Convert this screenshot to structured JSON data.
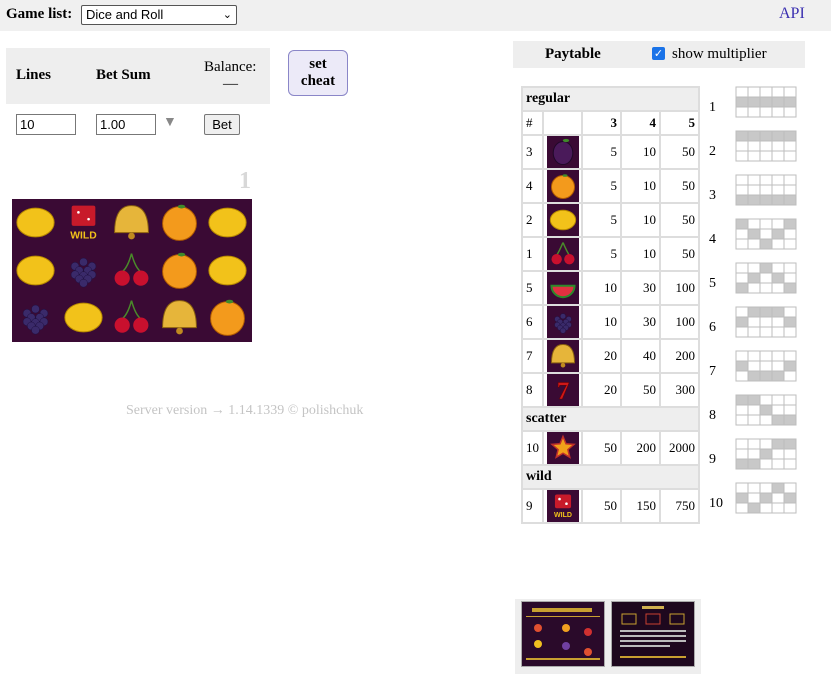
{
  "header": {
    "game_list_label": "Game list:",
    "selected_game": "Dice and Roll",
    "api_link": "API"
  },
  "controls": {
    "lines_label": "Lines",
    "bet_sum_label": "Bet Sum",
    "balance_label": "Balance:",
    "balance_value": "—",
    "cheat_line1": "set",
    "cheat_line2": "cheat",
    "lines_value": "10",
    "bet_value": "1.00",
    "bet_button": "Bet",
    "arrow": "▼"
  },
  "reels": {
    "number": "1",
    "grid": [
      [
        "lemon",
        "dice-wild",
        "bell",
        "orange",
        "lemon"
      ],
      [
        "lemon",
        "grapes",
        "cherry",
        "orange",
        "lemon"
      ],
      [
        "grapes",
        "lemon",
        "cherry",
        "bell",
        "orange"
      ]
    ]
  },
  "footer": {
    "text": "Server version → 1.14.1339   ©   polishchuk"
  },
  "paytable": {
    "title": "Paytable",
    "show_multiplier_label": "show multiplier",
    "show_multiplier_checked": true,
    "sections": [
      {
        "name": "regular",
        "header": [
          "#",
          "",
          "3",
          "4",
          "5"
        ],
        "rows": [
          {
            "id": "3",
            "icon": "plum",
            "v3": "5",
            "v4": "10",
            "v5": "50"
          },
          {
            "id": "4",
            "icon": "orange",
            "v3": "5",
            "v4": "10",
            "v5": "50"
          },
          {
            "id": "2",
            "icon": "lemon",
            "v3": "5",
            "v4": "10",
            "v5": "50"
          },
          {
            "id": "1",
            "icon": "cherry",
            "v3": "5",
            "v4": "10",
            "v5": "50"
          },
          {
            "id": "5",
            "icon": "watermelon",
            "v3": "10",
            "v4": "30",
            "v5": "100"
          },
          {
            "id": "6",
            "icon": "grapes",
            "v3": "10",
            "v4": "30",
            "v5": "100"
          },
          {
            "id": "7",
            "icon": "bell",
            "v3": "20",
            "v4": "40",
            "v5": "200"
          },
          {
            "id": "8",
            "icon": "seven",
            "v3": "20",
            "v4": "50",
            "v5": "300"
          }
        ]
      },
      {
        "name": "scatter",
        "rows": [
          {
            "id": "10",
            "icon": "star",
            "v3": "50",
            "v4": "200",
            "v5": "2000"
          }
        ]
      },
      {
        "name": "wild",
        "rows": [
          {
            "id": "9",
            "icon": "dice-wild",
            "v3": "50",
            "v4": "150",
            "v5": "750"
          }
        ]
      }
    ]
  },
  "paylines": [
    {
      "n": "1",
      "rows": [
        1,
        1,
        1,
        1,
        1
      ]
    },
    {
      "n": "2",
      "rows": [
        0,
        0,
        0,
        0,
        0
      ]
    },
    {
      "n": "3",
      "rows": [
        2,
        2,
        2,
        2,
        2
      ]
    },
    {
      "n": "4",
      "rows": [
        0,
        1,
        2,
        1,
        0
      ]
    },
    {
      "n": "5",
      "rows": [
        2,
        1,
        0,
        1,
        2
      ]
    },
    {
      "n": "6",
      "rows": [
        1,
        0,
        0,
        0,
        1
      ]
    },
    {
      "n": "7",
      "rows": [
        1,
        2,
        2,
        2,
        1
      ]
    },
    {
      "n": "8",
      "rows": [
        0,
        0,
        1,
        2,
        2
      ]
    },
    {
      "n": "9",
      "rows": [
        2,
        2,
        1,
        0,
        0
      ]
    },
    {
      "n": "10",
      "rows": [
        1,
        2,
        1,
        0,
        1
      ]
    }
  ],
  "colors": {
    "accent": "#1a73e8",
    "link": "#3a2fb0",
    "reel_bg": "#3a0a34",
    "line_cell": "#c8c8c8"
  }
}
